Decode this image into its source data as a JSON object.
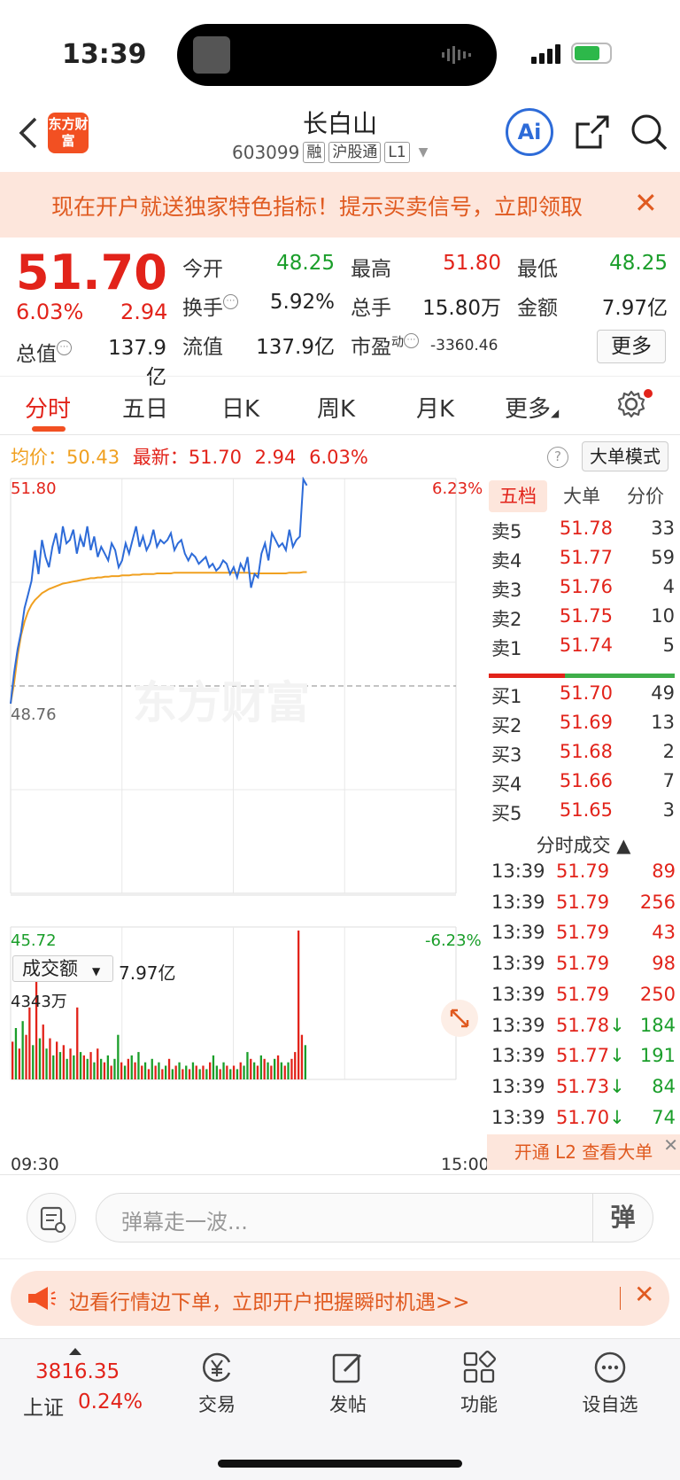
{
  "status": {
    "time": "13:39"
  },
  "header": {
    "logo": "东方财富",
    "stock_name": "长白山",
    "stock_code": "603099",
    "tags": [
      "融",
      "沪股通",
      "L1"
    ],
    "ai_label": "Ai"
  },
  "promo": {
    "text": "现在开户就送独家特色指标！提示买卖信号，立即领取",
    "close": "✕"
  },
  "quote": {
    "price": "51.70",
    "pct": "6.03%",
    "change": "2.94",
    "total_value_label": "总值",
    "total_value": "137.9亿",
    "fields": [
      {
        "label": "今开",
        "value": "48.25"
      },
      {
        "label": "最高",
        "value": "51.80"
      },
      {
        "label": "最低",
        "value": "48.25"
      },
      {
        "label": "换手",
        "value": "5.92%"
      },
      {
        "label": "总手",
        "value": "15.80万"
      },
      {
        "label": "金额",
        "value": "7.97亿"
      },
      {
        "label": "流值",
        "value": "137.9亿"
      },
      {
        "label": "市盈",
        "value": "-3360.46",
        "superscript": "动"
      }
    ],
    "more": "更多"
  },
  "tabs": [
    "分时",
    "五日",
    "日K",
    "周K",
    "月K",
    "更多"
  ],
  "chart_info": {
    "avg_label": "均价：",
    "avg_value": "50.43",
    "latest_label": "最新：",
    "latest_price": "51.70",
    "latest_change": "2.94",
    "latest_pct": "6.03%",
    "help": "?",
    "big_order_mode": "大单模式"
  },
  "chart_data": [
    {
      "type": "line",
      "title": "",
      "yticks_left": [
        "51.80",
        "48.76",
        "45.72"
      ],
      "yticks_right": [
        "6.23%",
        "-6.23%"
      ],
      "ylim": [
        45.72,
        51.8
      ],
      "prev_close": 48.76,
      "xticks": [
        "09:30",
        "15:00"
      ],
      "series": [
        {
          "name": "最新",
          "color": "#2d6bd8",
          "values": [
            48.5,
            48.95,
            49.3,
            49.55,
            49.9,
            50.1,
            50.3,
            50.75,
            50.4,
            50.9,
            50.65,
            50.5,
            50.8,
            51.0,
            50.7,
            51.1,
            50.85,
            50.9,
            51.05,
            50.7,
            50.95,
            50.8,
            51.1,
            50.75,
            50.95,
            50.65,
            50.8,
            50.7,
            50.6,
            50.85,
            50.75,
            50.5,
            50.6,
            50.85,
            50.7,
            50.9,
            51.1,
            50.8,
            50.95,
            50.75,
            50.85,
            51.05,
            50.8,
            50.9,
            50.85,
            50.9,
            51.0,
            50.75,
            50.85,
            50.9,
            50.7,
            50.6,
            50.7,
            50.65,
            50.55,
            50.6,
            50.65,
            50.5,
            50.55,
            50.45,
            50.5,
            50.6,
            50.55,
            50.4,
            50.5,
            50.35,
            50.55,
            50.45,
            50.65,
            50.2,
            50.4,
            50.35,
            50.7,
            50.85,
            50.6,
            51.0,
            50.9,
            50.8,
            50.85,
            50.75,
            51.05,
            50.8,
            50.9,
            50.95,
            51.79,
            51.7
          ]
        },
        {
          "name": "均价",
          "color": "#f0a020",
          "values": [
            48.5,
            48.8,
            49.2,
            49.5,
            49.7,
            49.85,
            49.95,
            50.02,
            50.07,
            50.12,
            50.15,
            50.18,
            50.2,
            50.22,
            50.24,
            50.26,
            50.27,
            50.28,
            50.29,
            50.3,
            50.31,
            50.32,
            50.33,
            50.34,
            50.34,
            50.35,
            50.35,
            50.36,
            50.36,
            50.37,
            50.37,
            50.37,
            50.38,
            50.38,
            50.38,
            50.39,
            50.39,
            50.39,
            50.4,
            50.4,
            50.4,
            50.4,
            50.41,
            50.41,
            50.41,
            50.41,
            50.41,
            50.42,
            50.42,
            50.42,
            50.42,
            50.42,
            50.42,
            50.42,
            50.42,
            50.42,
            50.42,
            50.42,
            50.42,
            50.42,
            50.42,
            50.42,
            50.42,
            50.42,
            50.42,
            50.42,
            50.42,
            50.42,
            50.42,
            50.41,
            50.41,
            50.41,
            50.41,
            50.41,
            50.41,
            50.41,
            50.41,
            50.41,
            50.41,
            50.41,
            50.42,
            50.42,
            50.42,
            50.42,
            50.43,
            50.43
          ]
        }
      ]
    },
    {
      "type": "bar",
      "title": "",
      "ylabel": "成交额",
      "total": "7.97亿",
      "ymax_label": "4343万",
      "ylim": [
        0,
        4343
      ],
      "values": [
        1100,
        1500,
        900,
        1700,
        1300,
        2100,
        1000,
        3100,
        1200,
        1600,
        900,
        1200,
        700,
        1100,
        800,
        1000,
        600,
        900,
        700,
        2100,
        800,
        700,
        600,
        800,
        500,
        900,
        600,
        500,
        700,
        400,
        600,
        1300,
        500,
        400,
        600,
        700,
        500,
        800,
        400,
        500,
        300,
        600,
        400,
        500,
        300,
        400,
        600,
        300,
        400,
        500,
        300,
        400,
        300,
        500,
        400,
        300,
        400,
        300,
        500,
        700,
        400,
        300,
        500,
        400,
        300,
        400,
        300,
        500,
        400,
        800,
        600,
        500,
        400,
        700,
        600,
        500,
        400,
        600,
        700,
        500,
        400,
        500,
        600,
        800,
        4343,
        1300,
        1000
      ],
      "colors": [
        "r",
        "g",
        "r",
        "g",
        "r",
        "r",
        "g",
        "r",
        "g",
        "r",
        "g",
        "r",
        "g",
        "r",
        "g",
        "r",
        "g",
        "r",
        "g",
        "r",
        "g",
        "r",
        "g",
        "r",
        "g",
        "r",
        "g",
        "r",
        "g",
        "r",
        "g",
        "g",
        "r",
        "g",
        "r",
        "g",
        "r",
        "g",
        "r",
        "g",
        "r",
        "g",
        "r",
        "g",
        "r",
        "g",
        "r",
        "g",
        "r",
        "g",
        "r",
        "g",
        "r",
        "g",
        "r",
        "g",
        "r",
        "g",
        "r",
        "g",
        "g",
        "r",
        "g",
        "r",
        "g",
        "r",
        "g",
        "r",
        "g",
        "g",
        "r",
        "g",
        "r",
        "g",
        "r",
        "g",
        "r",
        "g",
        "r",
        "g",
        "r",
        "g",
        "r",
        "r",
        "r",
        "r",
        "g"
      ]
    }
  ],
  "panel": {
    "tabs": [
      "五档",
      "大单",
      "分价"
    ],
    "sell": [
      {
        "label": "卖5",
        "price": "51.78",
        "vol": "33"
      },
      {
        "label": "卖4",
        "price": "51.77",
        "vol": "59"
      },
      {
        "label": "卖3",
        "price": "51.76",
        "vol": "4"
      },
      {
        "label": "卖2",
        "price": "51.75",
        "vol": "10"
      },
      {
        "label": "卖1",
        "price": "51.74",
        "vol": "5"
      }
    ],
    "buy": [
      {
        "label": "买1",
        "price": "51.70",
        "vol": "49"
      },
      {
        "label": "买2",
        "price": "51.69",
        "vol": "13"
      },
      {
        "label": "买3",
        "price": "51.68",
        "vol": "2"
      },
      {
        "label": "买4",
        "price": "51.66",
        "vol": "7"
      },
      {
        "label": "买5",
        "price": "51.65",
        "vol": "3"
      }
    ],
    "ticks_title": "分时成交 ▲",
    "ticks": [
      {
        "time": "13:39",
        "price": "51.79",
        "vol": "89",
        "dir": ""
      },
      {
        "time": "13:39",
        "price": "51.79",
        "vol": "256",
        "dir": ""
      },
      {
        "time": "13:39",
        "price": "51.79",
        "vol": "43",
        "dir": ""
      },
      {
        "time": "13:39",
        "price": "51.79",
        "vol": "98",
        "dir": ""
      },
      {
        "time": "13:39",
        "price": "51.79",
        "vol": "250",
        "dir": ""
      },
      {
        "time": "13:39",
        "price": "51.78",
        "vol": "184",
        "dir": "↓"
      },
      {
        "time": "13:39",
        "price": "51.77",
        "vol": "191",
        "dir": "↓"
      },
      {
        "time": "13:39",
        "price": "51.73",
        "vol": "84",
        "dir": "↓"
      },
      {
        "time": "13:39",
        "price": "51.70",
        "vol": "74",
        "dir": "↓"
      }
    ],
    "l2": "开通 L2 查看大单"
  },
  "volume": {
    "selector": "成交额",
    "total": "7.97亿",
    "max": "4343万"
  },
  "time_axis": {
    "start": "09:30",
    "end": "15:00"
  },
  "danmaku": {
    "placeholder": "弹幕走一波...",
    "send": "弹"
  },
  "bottom_promo": {
    "text": "边看行情边下单，立即开户把握瞬时机遇>>"
  },
  "bottom_nav": {
    "index_value": "3816.35",
    "index_name": "上证",
    "index_pct": "0.24%",
    "items": [
      "交易",
      "发帖",
      "功能",
      "设自选"
    ]
  }
}
